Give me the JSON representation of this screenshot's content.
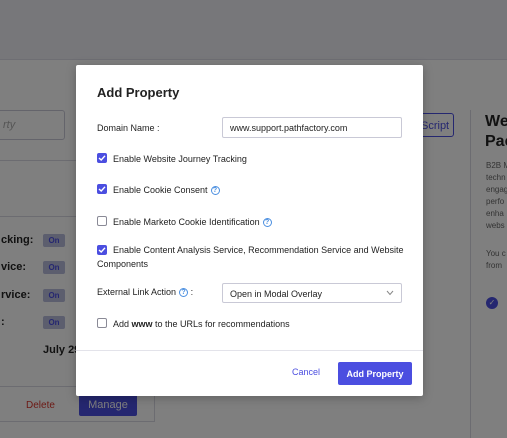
{
  "background": {
    "search_placeholder": "rty",
    "script_button_label": "Script",
    "rows": [
      {
        "label": "cking:",
        "status": "On"
      },
      {
        "label": "vice:",
        "status": "On"
      },
      {
        "label": "rvice:",
        "status": "On"
      },
      {
        "label": ":",
        "status": "On"
      }
    ],
    "date_text": "July 29",
    "delete_label": "Delete",
    "manage_label": "Manage",
    "panel_title_line1": "We",
    "panel_title_line2": "Pac",
    "panel_text": [
      "B2B M",
      "techn",
      "engag",
      "perfo",
      "enha",
      "webs",
      "",
      "You c",
      "from"
    ]
  },
  "modal": {
    "title": "Add Property",
    "domain_label": "Domain Name :",
    "domain_value": "www.support.pathfactory.com",
    "options": [
      {
        "label": "Enable Website Journey Tracking",
        "checked": true,
        "help": false
      },
      {
        "label": "Enable Cookie Consent",
        "checked": true,
        "help": true
      },
      {
        "label": "Enable Marketo Cookie Identification",
        "checked": false,
        "help": true
      },
      {
        "label": "Enable Content Analysis Service, Recommendation Service and Website Components",
        "checked": true,
        "help": false
      }
    ],
    "external_link_label": "External Link Action",
    "external_link_colon": ":",
    "external_link_value": "Open in Modal Overlay",
    "www_option": {
      "prefix": "Add ",
      "bold": "www",
      "suffix": " to the URLs for recommendations",
      "checked": false
    },
    "cancel_label": "Cancel",
    "submit_label": "Add Property"
  },
  "colors": {
    "accent": "#4b4ee0",
    "help": "#4b8fe0",
    "danger": "#d9342b"
  }
}
